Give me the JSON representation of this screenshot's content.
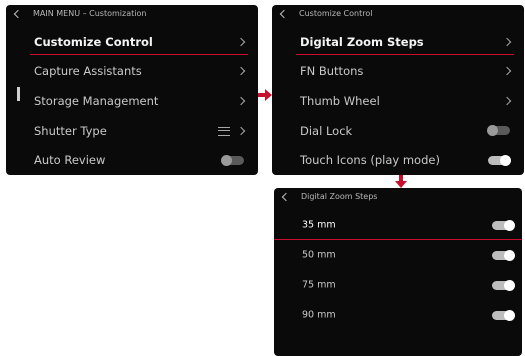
{
  "main_menu": {
    "title": "MAIN MENU – Customization",
    "items": [
      {
        "label": "Customize Control",
        "control": "chevron",
        "selected": true
      },
      {
        "label": "Capture Assistants",
        "control": "chevron",
        "selected": false
      },
      {
        "label": "Storage Management",
        "control": "chevron",
        "selected": false
      },
      {
        "label": "Shutter Type",
        "control": "mode-chevron",
        "selected": false
      },
      {
        "label": "Auto Review",
        "control": "toggle-off",
        "selected": false
      }
    ]
  },
  "customize_control": {
    "title": "Customize Control",
    "items": [
      {
        "label": "Digital Zoom Steps",
        "control": "chevron",
        "selected": true
      },
      {
        "label": "FN Buttons",
        "control": "chevron",
        "selected": false
      },
      {
        "label": "Thumb Wheel",
        "control": "chevron",
        "selected": false
      },
      {
        "label": "Dial Lock",
        "control": "toggle-off",
        "selected": false
      },
      {
        "label": "Touch Icons (play mode)",
        "control": "toggle-on",
        "selected": false
      }
    ]
  },
  "digital_zoom_steps": {
    "title": "Digital Zoom Steps",
    "items": [
      {
        "label": "35 mm",
        "control": "toggle-on",
        "selected": true
      },
      {
        "label": "50 mm",
        "control": "toggle-on",
        "selected": false
      },
      {
        "label": "75 mm",
        "control": "toggle-on",
        "selected": false
      },
      {
        "label": "90 mm",
        "control": "toggle-on",
        "selected": false
      }
    ]
  },
  "colors": {
    "accent": "#c8102e",
    "panel_bg": "#0a0a0a",
    "text": "#c9c9c9"
  },
  "icons": {
    "back": "chevron-left-icon",
    "submenu": "chevron-right-icon",
    "flow_arrow": "red-arrow-icon"
  }
}
